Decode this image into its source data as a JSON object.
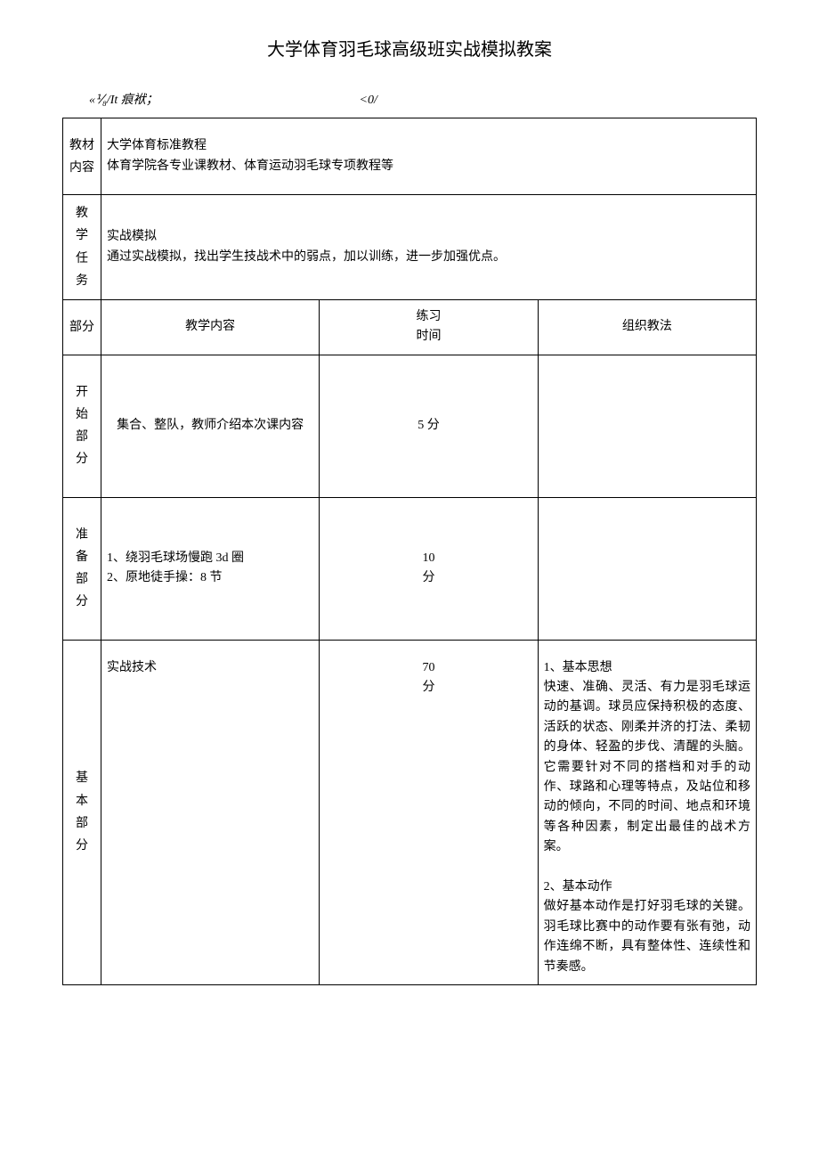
{
  "title": "大学体育羽毛球高级班实战模拟教案",
  "subheader_left": "«⅟₈/It 痕袱；",
  "subheader_right": "<0/",
  "rows": {
    "r1": {
      "label": "教材\n内容",
      "body": "大学体育标准教程\n体育学院各专业课教材、体育运动羽毛球专项教程等"
    },
    "r2": {
      "label": "教\n学\n任\n务",
      "body": "实战模拟\n通过实战模拟，找出学生技战术中的弱点，加以训练，进一步加强优点。"
    },
    "header": {
      "c1": "部分",
      "c2": "教学内容",
      "c3": "练习\n时间",
      "c4": "组织教法"
    },
    "start": {
      "label": "开\n始\n部\n分",
      "content": "集合、整队，教师介绍本次课内容",
      "time": "5 分",
      "method": ""
    },
    "prep": {
      "label": "准\n备\n部\n分",
      "content": "1、绕羽毛球场慢跑 3d 圈\n2、原地徒手操：8 节",
      "time": "10\n分",
      "method": ""
    },
    "basic": {
      "label": "基\n本\n部\n分",
      "content": "实战技术",
      "time": "70\n分",
      "method": "1、基本思想\n快速、准确、灵活、有力是羽毛球运动的基调。球员应保持积极的态度、活跃的状态、刚柔并济的打法、柔韧的身体、轻盈的步伐、清醒的头脑。它需要针对不同的搭档和对手的动作、球路和心理等特点，及站位和移动的倾向，不同的时间、地点和环境等各种因素，制定出最佳的战术方案。\n\n2、基本动作\n做好基本动作是打好羽毛球的关键。羽毛球比赛中的动作要有张有弛，动作连绵不断，具有整体性、连续性和节奏感。"
    }
  }
}
